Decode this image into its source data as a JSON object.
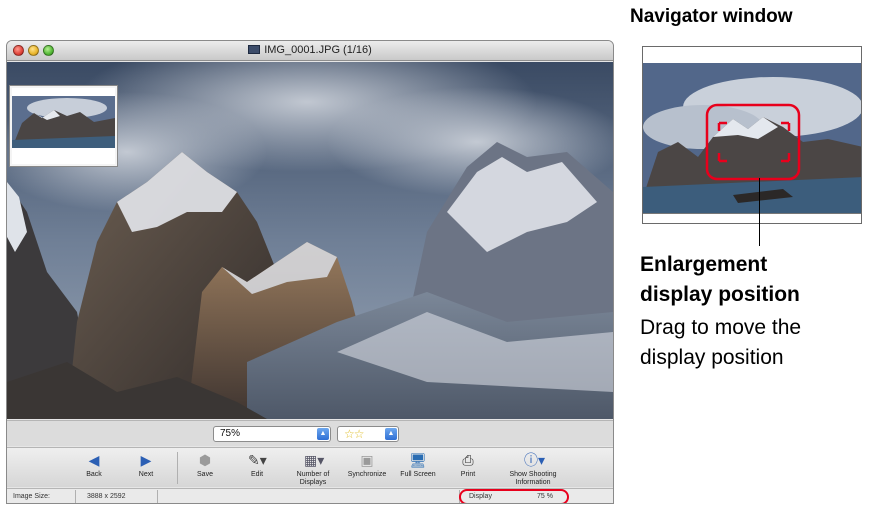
{
  "window": {
    "title": "IMG_0001.JPG (1/16)"
  },
  "zoom": {
    "value": "75%"
  },
  "rating": {
    "stars": "☆☆"
  },
  "toolbar": {
    "back": "Back",
    "next": "Next",
    "save": "Save",
    "edit": "Edit",
    "number_of_displays_1": "Number of",
    "number_of_displays_2": "Displays",
    "synchronize": "Synchronize",
    "full_screen": "Full Screen",
    "print": "Print",
    "show_shooting_1": "Show Shooting",
    "show_shooting_2": "Information"
  },
  "status": {
    "image_size_label": "Image Size:",
    "image_size_value": "3888 x 2592",
    "display_label": "Display",
    "display_value": "75 %"
  },
  "annotation": {
    "navigator_heading": "Navigator window",
    "title_line1": "Enlargement",
    "title_line2": "display position",
    "desc_line1": "Drag to move the",
    "desc_line2": "display position"
  },
  "colors": {
    "highlight": "#e8001c",
    "toolbar_icon": "#2b5fb4"
  },
  "icons": [
    "back-arrow-icon",
    "next-arrow-icon",
    "save-icon",
    "edit-icon",
    "number-of-displays-icon",
    "synchronize-icon",
    "full-screen-icon",
    "print-icon",
    "show-shooting-info-icon",
    "select-arrow-icon"
  ]
}
